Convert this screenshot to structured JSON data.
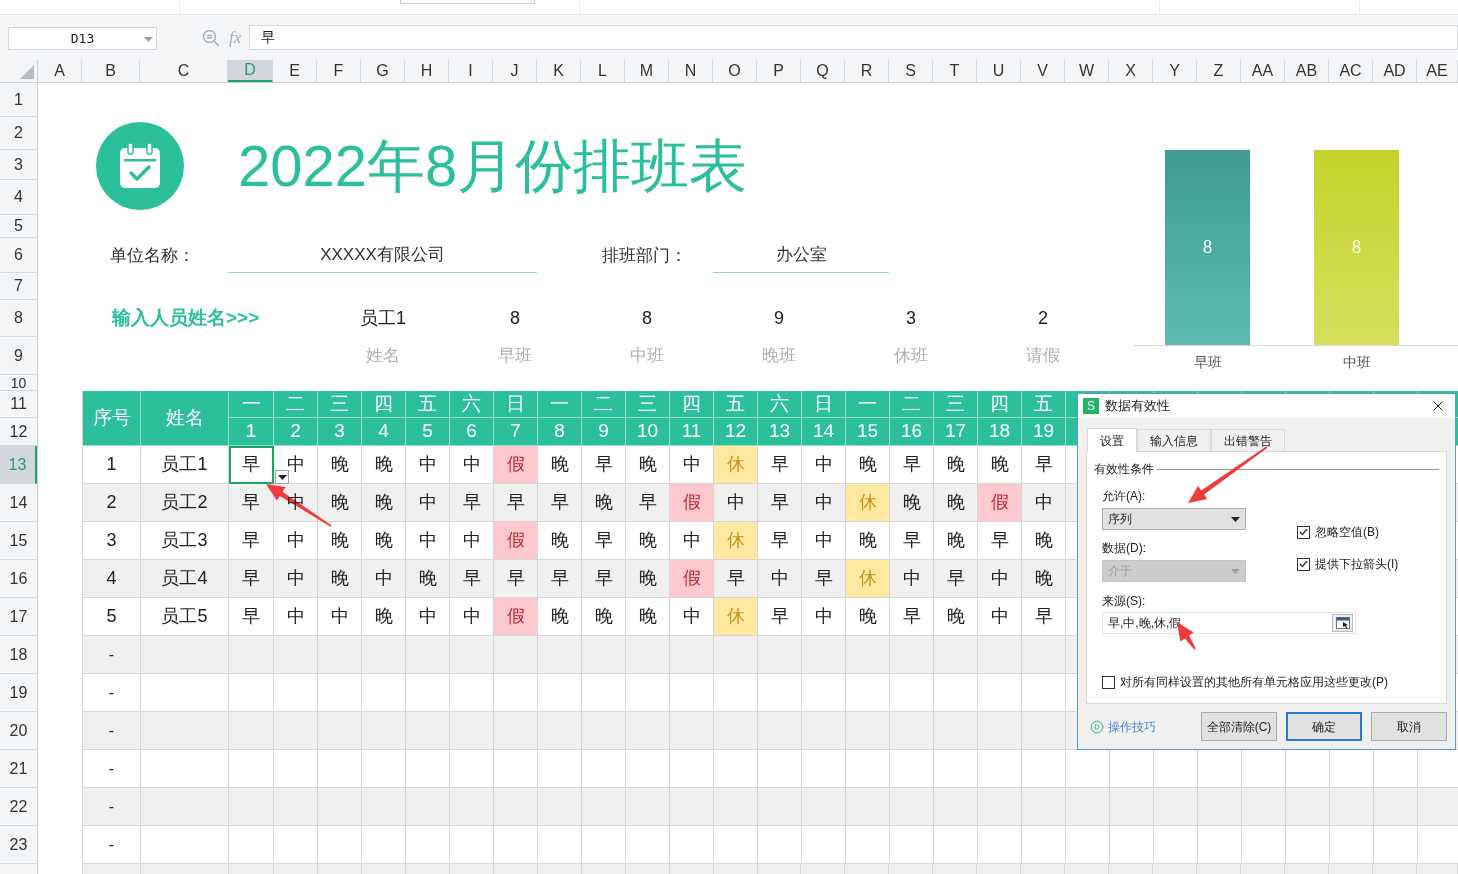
{
  "name_box": {
    "value": "D13"
  },
  "formula_bar": {
    "fx_label": "fx",
    "value": "早"
  },
  "columns": [
    {
      "label": "A",
      "selected": false
    },
    {
      "label": "B",
      "selected": false
    },
    {
      "label": "C",
      "selected": false
    },
    {
      "label": "D",
      "selected": true
    },
    {
      "label": "E",
      "selected": false
    },
    {
      "label": "F",
      "selected": false
    },
    {
      "label": "G",
      "selected": false
    },
    {
      "label": "H",
      "selected": false
    },
    {
      "label": "I",
      "selected": false
    },
    {
      "label": "J",
      "selected": false
    },
    {
      "label": "K",
      "selected": false
    },
    {
      "label": "L",
      "selected": false
    },
    {
      "label": "M",
      "selected": false
    },
    {
      "label": "N",
      "selected": false
    },
    {
      "label": "O",
      "selected": false
    },
    {
      "label": "P",
      "selected": false
    },
    {
      "label": "Q",
      "selected": false
    },
    {
      "label": "R",
      "selected": false
    },
    {
      "label": "S",
      "selected": false
    },
    {
      "label": "T",
      "selected": false
    },
    {
      "label": "U",
      "selected": false
    },
    {
      "label": "V",
      "selected": false
    },
    {
      "label": "W",
      "selected": false
    },
    {
      "label": "X",
      "selected": false
    },
    {
      "label": "Y",
      "selected": false
    },
    {
      "label": "Z",
      "selected": false
    },
    {
      "label": "AA",
      "selected": false
    },
    {
      "label": "AB",
      "selected": false
    },
    {
      "label": "AC",
      "selected": false
    },
    {
      "label": "AD",
      "selected": false
    },
    {
      "label": "AE",
      "selected": false
    }
  ],
  "rows": [
    {
      "label": "1",
      "selected": false
    },
    {
      "label": "2",
      "selected": false
    },
    {
      "label": "3",
      "selected": false
    },
    {
      "label": "4",
      "selected": false
    },
    {
      "label": "5",
      "selected": false
    },
    {
      "label": "6",
      "selected": false
    },
    {
      "label": "7",
      "selected": false
    },
    {
      "label": "8",
      "selected": false
    },
    {
      "label": "9",
      "selected": false
    },
    {
      "label": "10",
      "selected": false
    },
    {
      "label": "11",
      "selected": false
    },
    {
      "label": "12",
      "selected": false
    },
    {
      "label": "13",
      "selected": true
    },
    {
      "label": "14",
      "selected": false
    },
    {
      "label": "15",
      "selected": false
    },
    {
      "label": "16",
      "selected": false
    },
    {
      "label": "17",
      "selected": false
    },
    {
      "label": "18",
      "selected": false
    },
    {
      "label": "19",
      "selected": false
    },
    {
      "label": "20",
      "selected": false
    },
    {
      "label": "21",
      "selected": false
    },
    {
      "label": "22",
      "selected": false
    },
    {
      "label": "23",
      "selected": false
    }
  ],
  "sheet": {
    "title": "2022年8月份排班表",
    "company_label": "单位名称：",
    "company": "XXXXX有限公司",
    "department_label": "排班部门：",
    "department": "办公室",
    "prompt": "输入人员姓名>>>",
    "summary": [
      {
        "value": "员工1",
        "label": "姓名"
      },
      {
        "value": "8",
        "label": "早班"
      },
      {
        "value": "8",
        "label": "中班"
      },
      {
        "value": "9",
        "label": "晚班"
      },
      {
        "value": "3",
        "label": "休班"
      },
      {
        "value": "2",
        "label": "请假"
      }
    ],
    "chart": {
      "chart_data": {
        "type": "bar",
        "categories": [
          "早班",
          "中班"
        ],
        "values": [
          8,
          8
        ],
        "data_labels": true
      }
    }
  },
  "table": {
    "headers": [
      "序号",
      "姓名"
    ],
    "weekdays": [
      "一",
      "二",
      "三",
      "四",
      "五",
      "六",
      "日",
      "一",
      "二",
      "三",
      "四",
      "五",
      "六",
      "日",
      "一",
      "二",
      "三",
      "四",
      "五"
    ],
    "dates": [
      "1",
      "2",
      "3",
      "4",
      "5",
      "6",
      "7",
      "8",
      "9",
      "10",
      "11",
      "12",
      "13",
      "14",
      "15",
      "16",
      "17",
      "18",
      "19"
    ],
    "rows": [
      {
        "index": "1",
        "name": "员工1",
        "cells": [
          {
            "text": "早",
            "kind": "shift",
            "selected": true
          },
          {
            "text": "中",
            "kind": "shift",
            "selected": false
          },
          {
            "text": "晚",
            "kind": "shift",
            "selected": false
          },
          {
            "text": "晚",
            "kind": "shift",
            "selected": false
          },
          {
            "text": "中",
            "kind": "shift",
            "selected": false
          },
          {
            "text": "中",
            "kind": "shift",
            "selected": false
          },
          {
            "text": "假",
            "kind": "leave",
            "selected": false
          },
          {
            "text": "晚",
            "kind": "shift",
            "selected": false
          },
          {
            "text": "早",
            "kind": "shift",
            "selected": false
          },
          {
            "text": "晚",
            "kind": "shift",
            "selected": false
          },
          {
            "text": "中",
            "kind": "shift",
            "selected": false
          },
          {
            "text": "休",
            "kind": "rest",
            "selected": false
          },
          {
            "text": "早",
            "kind": "shift",
            "selected": false
          },
          {
            "text": "中",
            "kind": "shift",
            "selected": false
          },
          {
            "text": "晚",
            "kind": "shift",
            "selected": false
          },
          {
            "text": "早",
            "kind": "shift",
            "selected": false
          },
          {
            "text": "晚",
            "kind": "shift",
            "selected": false
          },
          {
            "text": "晚",
            "kind": "shift",
            "selected": false
          },
          {
            "text": "早",
            "kind": "shift",
            "selected": false
          }
        ]
      },
      {
        "index": "2",
        "name": "员工2",
        "cells": [
          {
            "text": "早",
            "kind": "shift",
            "selected": false
          },
          {
            "text": "中",
            "kind": "shift",
            "selected": false
          },
          {
            "text": "晚",
            "kind": "shift",
            "selected": false
          },
          {
            "text": "晚",
            "kind": "shift",
            "selected": false
          },
          {
            "text": "中",
            "kind": "shift",
            "selected": false
          },
          {
            "text": "早",
            "kind": "shift",
            "selected": false
          },
          {
            "text": "早",
            "kind": "shift",
            "selected": false
          },
          {
            "text": "早",
            "kind": "shift",
            "selected": false
          },
          {
            "text": "晚",
            "kind": "shift",
            "selected": false
          },
          {
            "text": "早",
            "kind": "shift",
            "selected": false
          },
          {
            "text": "假",
            "kind": "leave",
            "selected": false
          },
          {
            "text": "中",
            "kind": "shift",
            "selected": false
          },
          {
            "text": "早",
            "kind": "shift",
            "selected": false
          },
          {
            "text": "中",
            "kind": "shift",
            "selected": false
          },
          {
            "text": "休",
            "kind": "rest",
            "selected": false
          },
          {
            "text": "晚",
            "kind": "shift",
            "selected": false
          },
          {
            "text": "晚",
            "kind": "shift",
            "selected": false
          },
          {
            "text": "假",
            "kind": "leave",
            "selected": false
          },
          {
            "text": "中",
            "kind": "shift",
            "selected": false
          }
        ]
      },
      {
        "index": "3",
        "name": "员工3",
        "cells": [
          {
            "text": "早",
            "kind": "shift",
            "selected": false
          },
          {
            "text": "中",
            "kind": "shift",
            "selected": false
          },
          {
            "text": "晚",
            "kind": "shift",
            "selected": false
          },
          {
            "text": "晚",
            "kind": "shift",
            "selected": false
          },
          {
            "text": "中",
            "kind": "shift",
            "selected": false
          },
          {
            "text": "中",
            "kind": "shift",
            "selected": false
          },
          {
            "text": "假",
            "kind": "leave",
            "selected": false
          },
          {
            "text": "晚",
            "kind": "shift",
            "selected": false
          },
          {
            "text": "早",
            "kind": "shift",
            "selected": false
          },
          {
            "text": "晚",
            "kind": "shift",
            "selected": false
          },
          {
            "text": "中",
            "kind": "shift",
            "selected": false
          },
          {
            "text": "休",
            "kind": "rest",
            "selected": false
          },
          {
            "text": "早",
            "kind": "shift",
            "selected": false
          },
          {
            "text": "中",
            "kind": "shift",
            "selected": false
          },
          {
            "text": "晚",
            "kind": "shift",
            "selected": false
          },
          {
            "text": "早",
            "kind": "shift",
            "selected": false
          },
          {
            "text": "晚",
            "kind": "shift",
            "selected": false
          },
          {
            "text": "早",
            "kind": "shift",
            "selected": false
          },
          {
            "text": "晚",
            "kind": "shift",
            "selected": false
          }
        ]
      },
      {
        "index": "4",
        "name": "员工4",
        "cells": [
          {
            "text": "早",
            "kind": "shift",
            "selected": false
          },
          {
            "text": "中",
            "kind": "shift",
            "selected": false
          },
          {
            "text": "晚",
            "kind": "shift",
            "selected": false
          },
          {
            "text": "中",
            "kind": "shift",
            "selected": false
          },
          {
            "text": "晚",
            "kind": "shift",
            "selected": false
          },
          {
            "text": "早",
            "kind": "shift",
            "selected": false
          },
          {
            "text": "早",
            "kind": "shift",
            "selected": false
          },
          {
            "text": "早",
            "kind": "shift",
            "selected": false
          },
          {
            "text": "早",
            "kind": "shift",
            "selected": false
          },
          {
            "text": "晚",
            "kind": "shift",
            "selected": false
          },
          {
            "text": "假",
            "kind": "leave",
            "selected": false
          },
          {
            "text": "早",
            "kind": "shift",
            "selected": false
          },
          {
            "text": "中",
            "kind": "shift",
            "selected": false
          },
          {
            "text": "早",
            "kind": "shift",
            "selected": false
          },
          {
            "text": "休",
            "kind": "rest",
            "selected": false
          },
          {
            "text": "中",
            "kind": "shift",
            "selected": false
          },
          {
            "text": "早",
            "kind": "shift",
            "selected": false
          },
          {
            "text": "中",
            "kind": "shift",
            "selected": false
          },
          {
            "text": "晚",
            "kind": "shift",
            "selected": false
          }
        ]
      },
      {
        "index": "5",
        "name": "员工5",
        "cells": [
          {
            "text": "早",
            "kind": "shift",
            "selected": false
          },
          {
            "text": "中",
            "kind": "shift",
            "selected": false
          },
          {
            "text": "中",
            "kind": "shift",
            "selected": false
          },
          {
            "text": "晚",
            "kind": "shift",
            "selected": false
          },
          {
            "text": "中",
            "kind": "shift",
            "selected": false
          },
          {
            "text": "中",
            "kind": "shift",
            "selected": false
          },
          {
            "text": "假",
            "kind": "leave",
            "selected": false
          },
          {
            "text": "晚",
            "kind": "shift",
            "selected": false
          },
          {
            "text": "晚",
            "kind": "shift",
            "selected": false
          },
          {
            "text": "晚",
            "kind": "shift",
            "selected": false
          },
          {
            "text": "中",
            "kind": "shift",
            "selected": false
          },
          {
            "text": "休",
            "kind": "rest",
            "selected": false
          },
          {
            "text": "早",
            "kind": "shift",
            "selected": false
          },
          {
            "text": "中",
            "kind": "shift",
            "selected": false
          },
          {
            "text": "晚",
            "kind": "shift",
            "selected": false
          },
          {
            "text": "早",
            "kind": "shift",
            "selected": false
          },
          {
            "text": "晚",
            "kind": "shift",
            "selected": false
          },
          {
            "text": "中",
            "kind": "shift",
            "selected": false
          },
          {
            "text": "早",
            "kind": "shift",
            "selected": false
          }
        ]
      }
    ],
    "blank_rows": [
      {
        "index": "-"
      },
      {
        "index": "-"
      },
      {
        "index": "-"
      },
      {
        "index": "-"
      },
      {
        "index": "-"
      },
      {
        "index": "-"
      }
    ]
  },
  "dialog": {
    "badge": "S",
    "title": "数据有效性",
    "tabs": [
      {
        "label": "设置",
        "selected": true
      },
      {
        "label": "输入信息",
        "selected": false
      },
      {
        "label": "出错警告",
        "selected": false
      }
    ],
    "group": "有效性条件",
    "allow": {
      "label": "允许(A):",
      "value": "序列",
      "disabled": false
    },
    "data": {
      "label": "数据(D):",
      "value": "介于",
      "disabled": true
    },
    "options": [
      {
        "label": "忽略空值(B)",
        "checked": true
      },
      {
        "label": "提供下拉箭头(I)",
        "checked": true
      }
    ],
    "source": {
      "label": "来源(S):",
      "value": "早,中,晚,休,假"
    },
    "apply_all": {
      "label": "对所有同样设置的其他所有单元格应用这些更改(P)",
      "checked": false
    },
    "tips_link": "操作技巧",
    "buttons": [
      {
        "label": "全部清除(C)",
        "default": false
      },
      {
        "label": "确定",
        "default": true
      },
      {
        "label": "取消",
        "default": false
      }
    ]
  }
}
